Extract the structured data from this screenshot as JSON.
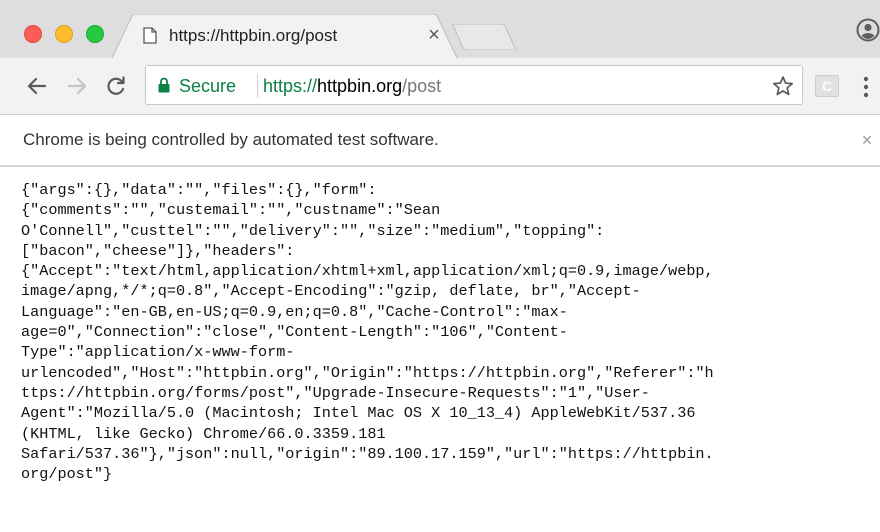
{
  "browser": {
    "tab": {
      "title": "https://httpbin.org/post",
      "close_label": "×"
    },
    "toolbar": {
      "security_label": "Secure",
      "url_scheme": "https://",
      "url_host": "httpbin.org",
      "url_path": "/post",
      "extension_label": "C"
    },
    "infobar": {
      "message": "Chrome is being controlled by automated test software.",
      "close_label": "×"
    }
  },
  "page": {
    "response_body": "{\"args\":{},\"data\":\"\",\"files\":{},\"form\":\n{\"comments\":\"\",\"custemail\":\"\",\"custname\":\"Sean\nO'Connell\",\"custtel\":\"\",\"delivery\":\"\",\"size\":\"medium\",\"topping\":\n[\"bacon\",\"cheese\"]},\"headers\":\n{\"Accept\":\"text/html,application/xhtml+xml,application/xml;q=0.9,image/webp,\nimage/apng,*/*;q=0.8\",\"Accept-Encoding\":\"gzip, deflate, br\",\"Accept-\nLanguage\":\"en-GB,en-US;q=0.9,en;q=0.8\",\"Cache-Control\":\"max-\nage=0\",\"Connection\":\"close\",\"Content-Length\":\"106\",\"Content-\nType\":\"application/x-www-form-\nurlencoded\",\"Host\":\"httpbin.org\",\"Origin\":\"https://httpbin.org\",\"Referer\":\"h\nttps://httpbin.org/forms/post\",\"Upgrade-Insecure-Requests\":\"1\",\"User-\nAgent\":\"Mozilla/5.0 (Macintosh; Intel Mac OS X 10_13_4) AppleWebKit/537.36\n(KHTML, like Gecko) Chrome/66.0.3359.181\nSafari/537.36\"},\"json\":null,\"origin\":\"89.100.17.159\",\"url\":\"https://httpbin.\norg/post\"}"
  },
  "colors": {
    "secure_green": "#0b8043",
    "tabstrip_bg": "#dedede",
    "toolbar_bg": "#f2f2f2",
    "close_red": "#fd5b56",
    "minimize_yellow": "#fdbc2e",
    "zoom_green": "#26c940"
  },
  "icons": {
    "window_controls": [
      "close-window-icon",
      "minimize-window-icon",
      "zoom-window-icon"
    ],
    "tab": "document-icon",
    "profile": "profile-icon",
    "back": "back-arrow-icon",
    "forward": "forward-arrow-icon",
    "reload": "reload-icon",
    "lock": "lock-icon",
    "bookmark": "star-icon",
    "menu": "three-dot-menu-icon"
  }
}
